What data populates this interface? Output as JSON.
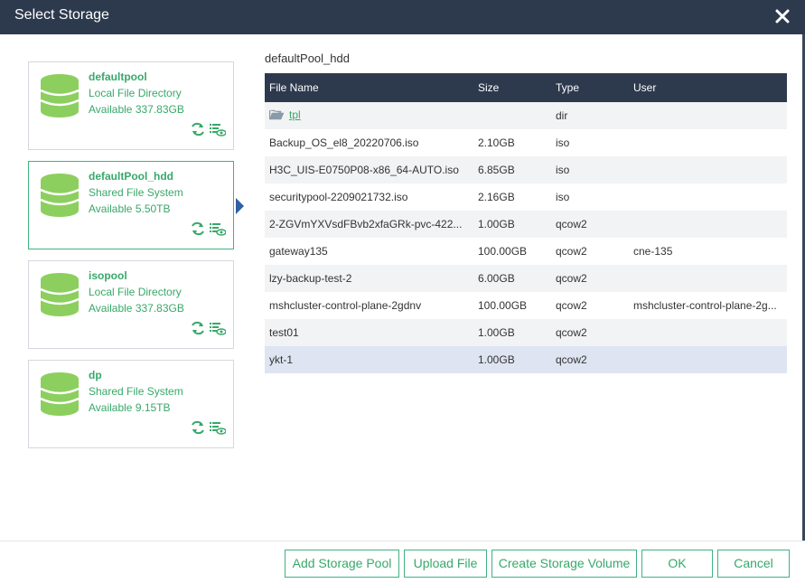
{
  "dialog": {
    "title": "Select Storage"
  },
  "pools": [
    {
      "name": "defaultpool",
      "type": "Local File Directory",
      "available": "Available 337.83GB"
    },
    {
      "name": "defaultPool_hdd",
      "type": "Shared File System",
      "available": "Available 5.50TB"
    },
    {
      "name": "isopool",
      "type": "Local File Directory",
      "available": "Available 337.83GB"
    },
    {
      "name": "dp",
      "type": "Shared File System",
      "available": "Available 9.15TB"
    }
  ],
  "selected_pool_title": "defaultPool_hdd",
  "table": {
    "headers": {
      "name": "File Name",
      "size": "Size",
      "type": "Type",
      "user": "User"
    },
    "rows": [
      {
        "name": "tpl",
        "size": "",
        "type": "dir",
        "user": ""
      },
      {
        "name": "Backup_OS_el8_20220706.iso",
        "size": "2.10GB",
        "type": "iso",
        "user": ""
      },
      {
        "name": "H3C_UIS-E0750P08-x86_64-AUTO.iso",
        "size": "6.85GB",
        "type": "iso",
        "user": ""
      },
      {
        "name": "securitypool-2209021732.iso",
        "size": "2.16GB",
        "type": "iso",
        "user": ""
      },
      {
        "name": "2-ZGVmYXVsdFBvb2xfaGRk-pvc-422...",
        "size": "1.00GB",
        "type": "qcow2",
        "user": ""
      },
      {
        "name": "gateway135",
        "size": "100.00GB",
        "type": "qcow2",
        "user": "cne-135"
      },
      {
        "name": "lzy-backup-test-2",
        "size": "6.00GB",
        "type": "qcow2",
        "user": ""
      },
      {
        "name": "mshcluster-control-plane-2gdnv",
        "size": "100.00GB",
        "type": "qcow2",
        "user": "mshcluster-control-plane-2g..."
      },
      {
        "name": "test01",
        "size": "1.00GB",
        "type": "qcow2",
        "user": ""
      },
      {
        "name": "ykt-1",
        "size": "1.00GB",
        "type": "qcow2",
        "user": ""
      }
    ]
  },
  "buttons": {
    "add_pool": "Add Storage Pool",
    "upload": "Upload File",
    "create_volume": "Create Storage Volume",
    "ok": "OK",
    "cancel": "Cancel"
  },
  "colors": {
    "header_bg": "#2d3a4e",
    "accent_green": "#3fb27f",
    "db_icon": "#8ccf5e",
    "selected_row": "#dfe4f2"
  }
}
